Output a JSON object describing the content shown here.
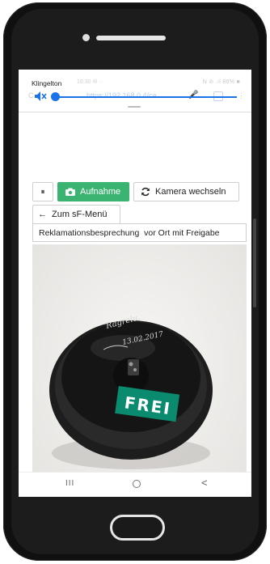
{
  "volume_panel": {
    "title": "Klingelton",
    "faded_url": "https://192.168.0.4/ca",
    "faded_status": "N ⊘ .ıl 86% ■",
    "faded_time": "16:30 ✉ ···"
  },
  "controls": {
    "pause_label": "⏸",
    "record_label": "Aufnahme",
    "switch_label": "Kamera wechseln",
    "menu_label": "Zum sF-Menü",
    "reclamation_text": "Reklamationsbesprechung  vor Ort mit Freigabe"
  },
  "video": {
    "sticker_text": "FREI",
    "handwriting": "Ragrelu.",
    "date_text": "13.02.2017"
  },
  "navbar": {
    "recent_label": "III",
    "back_label": "<"
  },
  "colors": {
    "accent_blue": "#1a73e8",
    "record_green": "#3bb371",
    "sticker_green": "#0a8a6e"
  }
}
